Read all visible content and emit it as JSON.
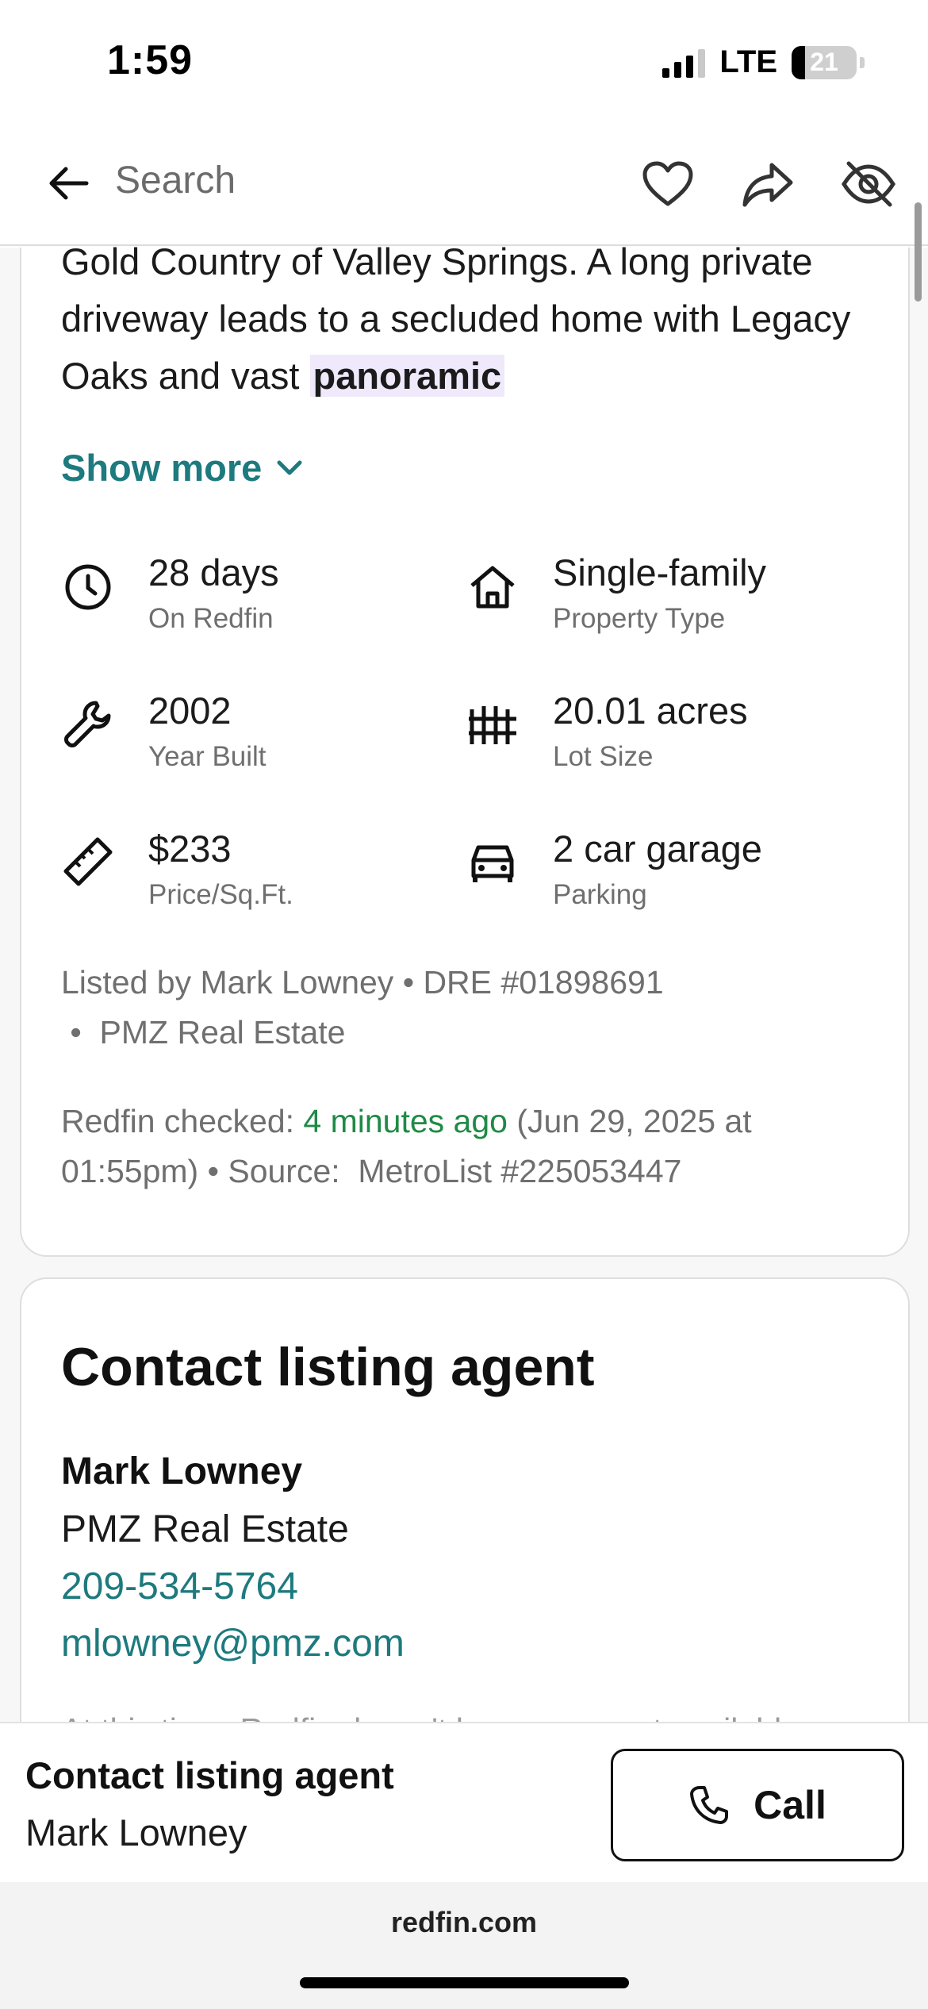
{
  "status_bar": {
    "time": "1:59",
    "network": "LTE",
    "battery": "21",
    "battery_level": 0.21
  },
  "nav": {
    "search_placeholder": "Search",
    "icons": [
      "back-arrow-icon",
      "heart-icon",
      "share-icon",
      "hide-eye-icon"
    ]
  },
  "description": {
    "text_before": "Gold Country of Valley Springs. A long private driveway leads to a secluded home with Legacy Oaks and vast ",
    "highlight": "panoramic",
    "show_more": "Show more"
  },
  "facts": [
    {
      "value": "28 days",
      "label": "On Redfin",
      "icon": "clock-icon"
    },
    {
      "value": "Single-family",
      "label": "Property Type",
      "icon": "house-icon"
    },
    {
      "value": "2002",
      "label": "Year Built",
      "icon": "wrench-icon"
    },
    {
      "value": "20.01 acres",
      "label": "Lot Size",
      "icon": "fence-icon"
    },
    {
      "value": "$233",
      "label": "Price/Sq.Ft.",
      "icon": "ruler-icon"
    },
    {
      "value": "2 car garage",
      "label": "Parking",
      "icon": "car-icon"
    }
  ],
  "listing": {
    "listed_by_line1": "Listed by Mark Lowney • DRE #01898691",
    "listed_by_line2": " •  PMZ Real Estate",
    "checked_prefix": "Redfin checked: ",
    "checked_time": "4 minutes ago",
    "checked_rest": " (Jun 29, 2025 at 01:55pm) • Source:  MetroList #225053447"
  },
  "contact_card": {
    "title": "Contact listing agent",
    "agent_name": "Mark Lowney",
    "office": "PMZ Real Estate",
    "phone": "209-534-5764",
    "email": "mlowney@pmz.com",
    "cut_off_text": "At this time, Redfin doesn't have an agent available"
  },
  "sticky": {
    "title": "Contact listing agent",
    "agent_name": "Mark Lowney",
    "call_label": "Call"
  },
  "browser": {
    "url": "redfin.com"
  },
  "colors": {
    "teal": "#1d7a7e",
    "green": "#1f8a45",
    "highlight": "#efe9fb"
  }
}
